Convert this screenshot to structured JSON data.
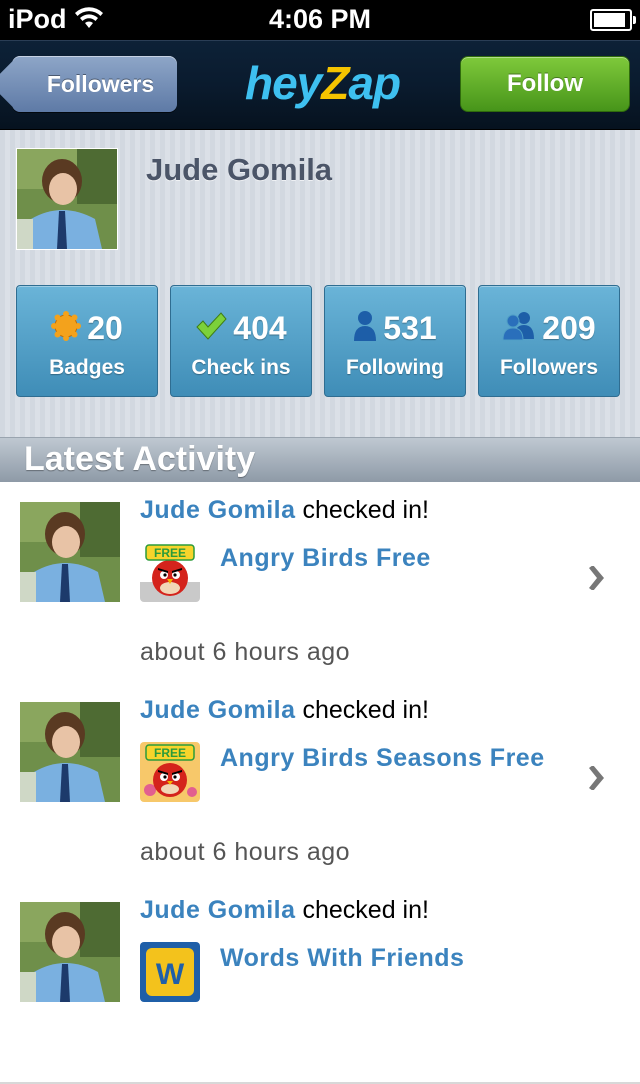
{
  "status_bar": {
    "carrier": "iPod",
    "time": "4:06 PM",
    "battery_level": 0.92
  },
  "nav": {
    "back_label": "Followers",
    "logo_part1": "hey",
    "logo_z": "Z",
    "logo_part2": "ap",
    "follow_label": "Follow"
  },
  "profile": {
    "name": "Jude Gomila",
    "stats": [
      {
        "value": "20",
        "label": "Badges",
        "icon": "badge-icon"
      },
      {
        "value": "404",
        "label": "Check ins",
        "icon": "checkmark-icon"
      },
      {
        "value": "531",
        "label": "Following",
        "icon": "person-icon"
      },
      {
        "value": "209",
        "label": "Followers",
        "icon": "people-icon"
      }
    ]
  },
  "section": {
    "title": "Latest Activity"
  },
  "activities": [
    {
      "user": "Jude Gomila",
      "action": " checked in!",
      "game": "Angry Birds Free",
      "time": "about 6 hours ago"
    },
    {
      "user": "Jude Gomila",
      "action": " checked in!",
      "game": "Angry Birds Seasons Free",
      "time": "about 6 hours ago"
    },
    {
      "user": "Jude Gomila",
      "action": " checked in!",
      "game": "Words With Friends",
      "time": ""
    }
  ],
  "colors": {
    "link_blue": "#3b83be",
    "follow_green": "#5fae2a",
    "stat_blue": "#4f9ec6",
    "nav_dark": "#0a1b2e"
  }
}
